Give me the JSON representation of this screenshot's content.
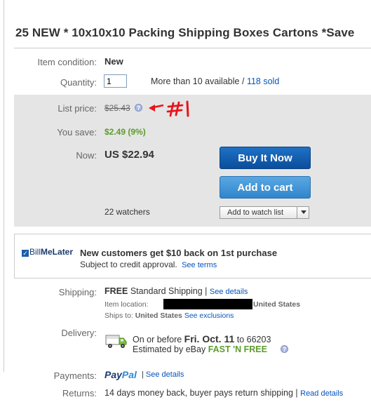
{
  "title": "25 NEW * 10x10x10 Packing Shipping Boxes Cartons *Save",
  "condition": {
    "label": "Item condition:",
    "value": "New"
  },
  "quantity": {
    "label": "Quantity:",
    "value": "1",
    "available": "More than 10 available",
    "separator": "/",
    "sold": "118 sold"
  },
  "list_price": {
    "label": "List price:",
    "value": "$25.43",
    "annotation": "#1"
  },
  "you_save": {
    "label": "You save:",
    "value": "$2.49 (9%)"
  },
  "now": {
    "label": "Now:",
    "value": "US $22.94"
  },
  "buttons": {
    "buy_it_now": "Buy It Now",
    "add_to_cart": "Add to cart",
    "add_to_watch_list": "Add to watch list"
  },
  "watchers": "22 watchers",
  "bill_me_later": {
    "logo_prefix": "Bill",
    "logo_suffix": "MeLater",
    "headline": "New customers get $10 back on 1st purchase",
    "sub": "Subject to credit approval.",
    "link": "See terms"
  },
  "shipping": {
    "label": "Shipping:",
    "free": "FREE",
    "method": "Standard Shipping |",
    "details_link": "See details",
    "location_label": "Item location:",
    "location_country": "United States",
    "ships_to_label": "Ships to:",
    "ships_to_value": "United States",
    "exclusions_link": "See exclusions"
  },
  "delivery": {
    "label": "Delivery:",
    "prefix": "On or before",
    "date": "Fri. Oct. 11",
    "zip_text": "to 66203",
    "estimated": "Estimated by eBay",
    "fast": "FAST 'N FREE"
  },
  "payments": {
    "label": "Payments:",
    "paypal_1": "Pay",
    "paypal_2": "Pal",
    "separator": "|",
    "link": "See details"
  },
  "returns": {
    "label": "Returns:",
    "value": "14 days money back, buyer pays return shipping",
    "separator": "|",
    "link": "Read details"
  },
  "colors": {
    "link": "#0654ba",
    "buy_button": "#0b4d9b",
    "cart_button": "#3b8fd3",
    "save_green": "#5d9c2d",
    "annotation_red": "#e8131b",
    "price_box": "#e5e5e5"
  },
  "icons": [
    "help-icon",
    "truck-icon",
    "dropdown-arrow-icon",
    "checkmark-icon"
  ]
}
